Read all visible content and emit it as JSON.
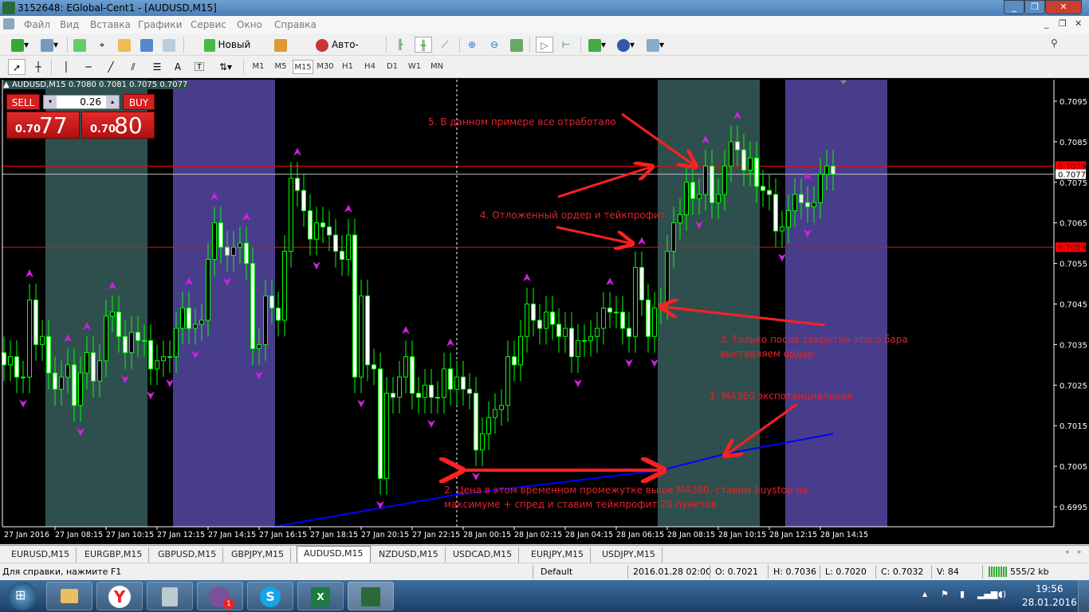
{
  "window": {
    "title": "3152648: EGlobal-Cent1 - [AUDUSD,M15]"
  },
  "menu": [
    "Файл",
    "Вид",
    "Вставка",
    "Графики",
    "Сервис",
    "Окно",
    "Справка"
  ],
  "toolbar": {
    "new_order": "Новый ордер",
    "auto_trading": "Авто-торговля"
  },
  "timeframes": [
    "M1",
    "M5",
    "M15",
    "M30",
    "H1",
    "H4",
    "D1",
    "W1",
    "MN"
  ],
  "active_timeframe": "M15",
  "search": {
    "value": ""
  },
  "chart": {
    "header": "AUDUSD,M15  0.7080 0.7081 0.7075 0.7077",
    "trade_panel": {
      "sell": "SELL",
      "buy": "BUY",
      "lot": "0.26",
      "sell_small": "0.70",
      "sell_big": "77",
      "buy_small": "0.70",
      "buy_big": "80"
    },
    "annotations": {
      "n1": "1. MA360 экспотенциальная",
      "n2a": "2. Цена в этом временном промежутке выше MA360, ставим buystop на",
      "n2b": "максимуме + спред и ставим тейкпрофит 20 пунктов",
      "n3a": "3. Только после закрытия этого бара",
      "n3b": "выставляем ордер",
      "n4": "4. Отложенный ордер и тейкпрофит",
      "n5": "5. В данном примере все отработало"
    }
  },
  "chart_data": {
    "type": "candlestick",
    "symbol": "AUDUSD",
    "timeframe": "M15",
    "ylim": [
      0.699,
      0.71
    ],
    "y_ticks": [
      "0.7095",
      "0.7085",
      "0.7075",
      "0.7065",
      "0.7055",
      "0.7045",
      "0.7035",
      "0.7025",
      "0.7015",
      "0.7005",
      "0.6995"
    ],
    "x_ticks": [
      "27 Jan 2016",
      "27 Jan 08:15",
      "27 Jan 10:15",
      "27 Jan 12:15",
      "27 Jan 14:15",
      "27 Jan 16:15",
      "27 Jan 18:15",
      "27 Jan 20:15",
      "27 Jan 22:15",
      "28 Jan 00:15",
      "28 Jan 02:15",
      "28 Jan 04:15",
      "28 Jan 06:15",
      "28 Jan 08:15",
      "28 Jan 10:15",
      "28 Jan 12:15",
      "28 Jan 14:15"
    ],
    "close": [
      0.703,
      0.7032,
      0.7027,
      0.7027,
      0.7046,
      0.7035,
      0.7037,
      0.7028,
      0.7024,
      0.7027,
      0.703,
      0.702,
      0.7028,
      0.7033,
      0.7026,
      0.7031,
      0.7042,
      0.7043,
      0.7037,
      0.7033,
      0.7038,
      0.7036,
      0.7036,
      0.7029,
      0.7031,
      0.7032,
      0.7032,
      0.7039,
      0.7044,
      0.7039,
      0.704,
      0.7041,
      0.7056,
      0.7065,
      0.7059,
      0.7057,
      0.7059,
      0.706,
      0.7055,
      0.7034,
      0.7035,
      0.7047,
      0.7044,
      0.7041,
      0.7058,
      0.7076,
      0.7073,
      0.7068,
      0.7061,
      0.7065,
      0.7064,
      0.7062,
      0.7058,
      0.7056,
      0.7062,
      0.7027,
      0.7047,
      0.703,
      0.7029,
      0.7002,
      0.7023,
      0.7022,
      0.7027,
      0.7032,
      0.7023,
      0.7022,
      0.7025,
      0.7022,
      0.7022,
      0.7029,
      0.7024,
      0.7027,
      0.7024,
      0.7023,
      0.7009,
      0.7013,
      0.7017,
      0.7019,
      0.702,
      0.7032,
      0.703,
      0.7037,
      0.7045,
      0.7041,
      0.7039,
      0.7043,
      0.704,
      0.7037,
      0.7039,
      0.7032,
      0.7036,
      0.7036,
      0.7037,
      0.7039,
      0.7044,
      0.7043,
      0.7043,
      0.7039,
      0.7037,
      0.7054,
      0.7046,
      0.7037,
      0.7044,
      0.7045,
      0.7058,
      0.7065,
      0.7067,
      0.7075,
      0.7071,
      0.7072,
      0.7079,
      0.707,
      0.7072,
      0.7079,
      0.7085,
      0.7083,
      0.7078,
      0.7081,
      0.7074,
      0.7073,
      0.7072,
      0.7063,
      0.7064,
      0.7068,
      0.7072,
      0.707,
      0.7069,
      0.707,
      0.7077,
      0.7079,
      0.7077
    ],
    "fractal_up_bars": [
      4,
      10,
      13,
      17,
      29,
      33,
      38,
      46,
      54,
      63,
      70,
      82,
      95,
      100,
      110,
      115,
      126
    ],
    "fractal_down_bars": [
      3,
      12,
      19,
      23,
      26,
      30,
      35,
      40,
      49,
      56,
      59,
      67,
      74,
      90,
      98,
      102,
      109,
      122,
      126
    ],
    "ma360": {
      "bars": [
        42,
        71,
        103,
        113,
        130
      ],
      "values": [
        0.699,
        0.6998,
        0.7004,
        0.7008,
        0.7013
      ]
    },
    "hlines": [
      {
        "price": 0.7079,
        "label": "0.7079",
        "color": "#ff0000"
      },
      {
        "price": 0.7059,
        "label": "0.7059",
        "color": "#ff0000"
      },
      {
        "price": 0.7077,
        "label": "0.7077",
        "color": "#c0c0c0"
      }
    ],
    "session_bands": [
      {
        "from": 7,
        "to": 23,
        "color": "#2f4f4f"
      },
      {
        "from": 27,
        "to": 43,
        "color": "#483d8b"
      },
      {
        "from": 103,
        "to": 119,
        "color": "#2f4f4f"
      },
      {
        "from": 123,
        "to": 139,
        "color": "#483d8b"
      }
    ],
    "cursor_bar": 71,
    "colors": {
      "bull": "#000000",
      "bear": "#ffffff",
      "outline": "#00ff00",
      "fractal": "#d020e0",
      "ma": "#0000ff"
    }
  },
  "tabs": [
    "EURUSD,M15",
    "EURGBP,M15",
    "GBPUSD,M15",
    "GBPJPY,M15",
    "AUDUSD,M15",
    "NZDUSD,M15",
    "USDCAD,M15",
    "EURJPY,M15",
    "USDJPY,M15"
  ],
  "active_tab": "AUDUSD,M15",
  "status": {
    "help": "Для справки, нажмите F1",
    "profile": "Default",
    "time": "2016.01.28 02:00",
    "open": "O: 0.7021",
    "high": "H: 0.7036",
    "low": "L: 0.7020",
    "close": "C: 0.7032",
    "volume": "V: 84",
    "traffic": "555/2 kb"
  },
  "taskbar": {
    "time": "19:56",
    "date": "28.01.2016",
    "viber_badge": "1"
  }
}
